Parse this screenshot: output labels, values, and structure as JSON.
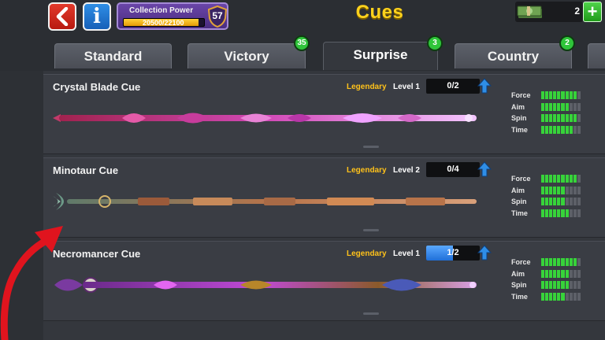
{
  "header": {
    "title": "Cues",
    "collection_power": {
      "label": "Collection Power",
      "value": "20500/22100",
      "current": 20500,
      "max": 22100,
      "badge": "57"
    },
    "cash_count": "2"
  },
  "tabs": [
    {
      "label": "Standard",
      "badge": ""
    },
    {
      "label": "Victory",
      "badge": "35"
    },
    {
      "label": "Surprise",
      "badge": "3"
    },
    {
      "label": "Country",
      "badge": "2"
    }
  ],
  "cues": [
    {
      "name": "Crystal Blade Cue",
      "rarity": "Legendary",
      "level": "Level 1",
      "progress": "0/2",
      "progress_fraction": 0.0,
      "stats": [
        {
          "label": "Force",
          "filled": 9
        },
        {
          "label": "Aim",
          "filled": 7
        },
        {
          "label": "Spin",
          "filled": 9
        },
        {
          "label": "Time",
          "filled": 8
        }
      ]
    },
    {
      "name": "Minotaur Cue",
      "rarity": "Legendary",
      "level": "Level 2",
      "progress": "0/4",
      "progress_fraction": 0.0,
      "stats": [
        {
          "label": "Force",
          "filled": 9
        },
        {
          "label": "Aim",
          "filled": 6
        },
        {
          "label": "Spin",
          "filled": 6
        },
        {
          "label": "Time",
          "filled": 7
        }
      ]
    },
    {
      "name": "Necromancer Cue",
      "rarity": "Legendary",
      "level": "Level 1",
      "progress": "1/2",
      "progress_fraction": 0.5,
      "stats": [
        {
          "label": "Force",
          "filled": 9
        },
        {
          "label": "Aim",
          "filled": 7
        },
        {
          "label": "Spin",
          "filled": 7
        },
        {
          "label": "Time",
          "filled": 6
        }
      ]
    }
  ],
  "colors": {
    "accent_yellow": "#ffd21c",
    "legendary": "#ffc21a",
    "stat_on": "#37d33a",
    "stat_off": "#5d6068",
    "badge_green": "#2fc53a",
    "back_red": "#d52b1e",
    "info_blue": "#2479d4",
    "arrow_red": "#e0141e"
  },
  "icons": {
    "back": "chevron-left-icon",
    "info": "info-icon",
    "shield": "shield-icon",
    "cash": "cash-stack-icon",
    "add": "plus-icon",
    "upgrade": "arrow-up-icon"
  }
}
